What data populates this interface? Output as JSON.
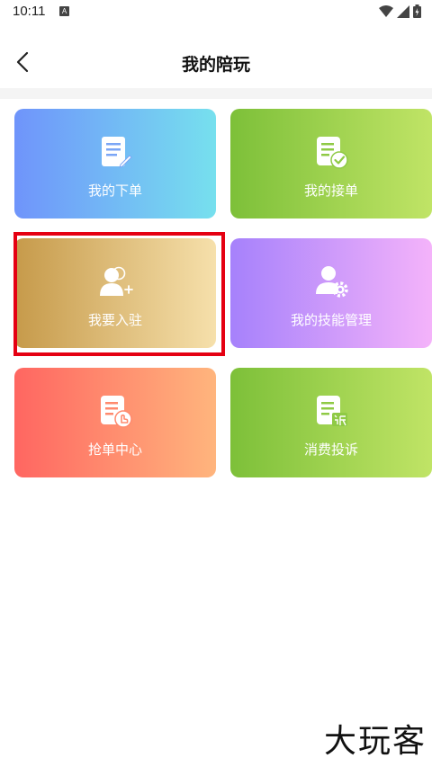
{
  "status_bar": {
    "time": "10:11",
    "badge": "A"
  },
  "nav": {
    "title": "我的陪玩"
  },
  "cards": [
    {
      "label": "我的下单",
      "icon": "document-edit-icon"
    },
    {
      "label": "我的接单",
      "icon": "document-check-icon"
    },
    {
      "label": "我要入驻",
      "icon": "add-user-icon"
    },
    {
      "label": "我的技能管理",
      "icon": "user-settings-icon"
    },
    {
      "label": "抢单中心",
      "icon": "document-touch-icon"
    },
    {
      "label": "消费投诉",
      "icon": "document-complaint-icon"
    }
  ],
  "watermark": "大玩客",
  "colors": {
    "highlight": "#e50012"
  }
}
